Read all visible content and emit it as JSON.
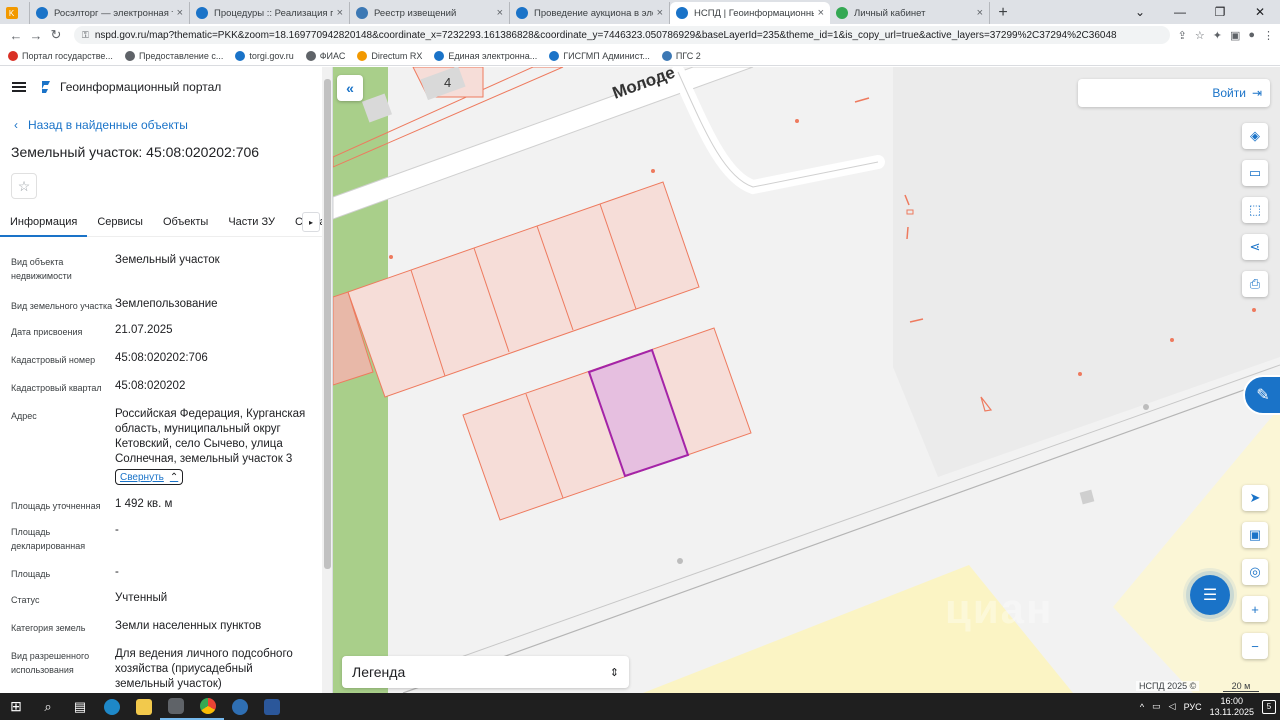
{
  "browser": {
    "tabs": [
      {
        "label": "",
        "color": "#f29900",
        "active": false
      },
      {
        "label": "Росэлторг — электронная торго",
        "color": "#1a73c8",
        "active": false
      },
      {
        "label": "Процедуры :: Реализация госи",
        "color": "#1a73c8",
        "active": false
      },
      {
        "label": "Реестр извещений",
        "color": "#3c78b4",
        "active": false
      },
      {
        "label": "Проведение аукциона в электр",
        "color": "#1a73c8",
        "active": false
      },
      {
        "label": "НСПД | Геоинформационный п",
        "color": "#1a73c8",
        "active": true
      },
      {
        "label": "Личный кабинет",
        "color": "#34a853",
        "active": false
      }
    ],
    "url": "nspd.gov.ru/map?thematic=PKK&zoom=18.169770942820148&coordinate_x=7232293.161386828&coordinate_y=7446323.050786929&baseLayerId=235&theme_id=1&is_copy_url=true&active_layers=37299%2C37294%2C36048",
    "bookmarks": [
      {
        "label": "Портал государстве...",
        "color": "#d93025"
      },
      {
        "label": "Предоставление с...",
        "color": "#5f6368"
      },
      {
        "label": "torgi.gov.ru",
        "color": "#1a73c8"
      },
      {
        "label": "ФИАС",
        "color": "#5f6368"
      },
      {
        "label": "Directum RX",
        "color": "#f29900"
      },
      {
        "label": "Единая электронна...",
        "color": "#1a73c8"
      },
      {
        "label": "ГИСГМП Админист...",
        "color": "#1a73c8"
      },
      {
        "label": "ПГС 2",
        "color": "#3c78b4"
      }
    ]
  },
  "panel": {
    "portal_title": "Геоинформационный портал",
    "back_label": "Назад в найденные объекты",
    "object_title": "Земельный участок: 45:08:020202:706",
    "tabs": [
      "Информация",
      "Сервисы",
      "Объекты",
      "Части ЗУ",
      "Соста"
    ],
    "collapse_label": "Свернуть",
    "rows": [
      {
        "label": "Вид объекта недвижимости",
        "value": "Земельный участок"
      },
      {
        "label": "Вид земельного участка",
        "value": "Землепользование"
      },
      {
        "label": "Дата присвоения",
        "value": "21.07.2025"
      },
      {
        "label": "Кадастровый номер",
        "value": "45:08:020202:706"
      },
      {
        "label": "Кадастровый квартал",
        "value": "45:08:020202"
      },
      {
        "label": "Адрес",
        "value": "Российская Федерация, Курганская область, муниципальный округ Кетовский, село Сычево, улица Солнечная, земельный участок 3"
      },
      {
        "label": "Площадь уточненная",
        "value": "1 492 кв. м"
      },
      {
        "label": "Площадь декларированная",
        "value": "-"
      },
      {
        "label": "Площадь",
        "value": "-"
      },
      {
        "label": "Статус",
        "value": "Учтенный"
      },
      {
        "label": "Категория земель",
        "value": "Земли населенных пунктов"
      },
      {
        "label": "Вид разрешенного использования",
        "value": "Для ведения личного подсобного хозяйства (приусадебный земельный участок)"
      }
    ]
  },
  "map": {
    "login_label": "Войти",
    "legend_label": "Легенда",
    "street_label": "Молоде",
    "house_number": "4",
    "copyright": "НСПД 2025 ©",
    "scale_label": "20 м",
    "watermark": "циан",
    "colors": {
      "parcel_fill": "#f6ddd8",
      "parcel_stroke": "#ee7a5e",
      "selected_fill": "#e6bfe0",
      "selected_stroke": "#a424a8",
      "green_strip": "#a9cf8a",
      "yellow_zone": "#fbf4c4",
      "grey_block": "#e2e2e2"
    }
  },
  "taskbar": {
    "lang": "РУС",
    "time": "16:00",
    "date": "13.11.2025",
    "notifications": "5"
  }
}
